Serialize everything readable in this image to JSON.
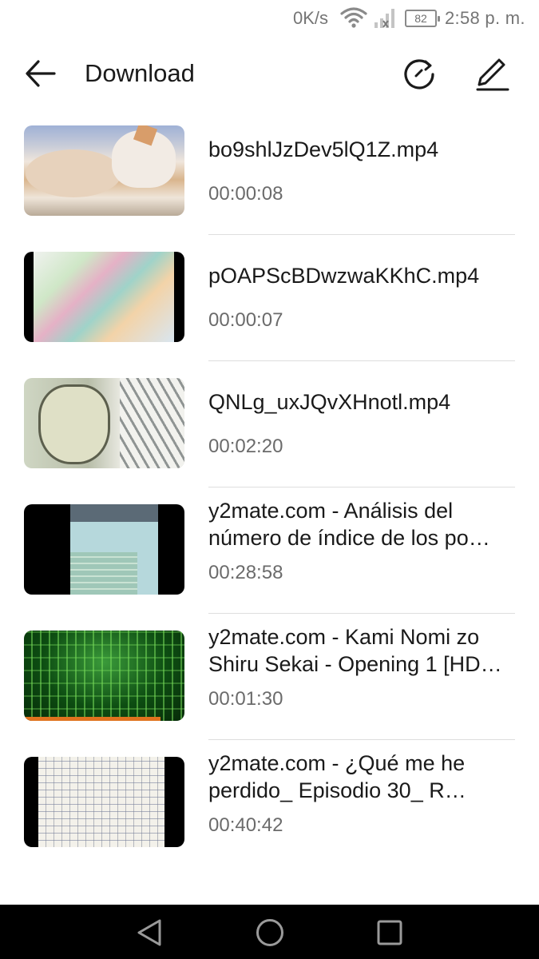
{
  "status_bar": {
    "speed": "0K/s",
    "battery": "82",
    "time": "2:58 p. m."
  },
  "app_bar": {
    "title": "Download",
    "back_icon": "arrow-left-icon",
    "refresh_icon": "refresh-icon",
    "edit_icon": "pencil-icon"
  },
  "videos": [
    {
      "title": "bo9shlJzDev5lQ1Z.mp4",
      "duration": "00:00:08"
    },
    {
      "title": "pOAPScBDwzwaKKhC.mp4",
      "duration": "00:00:07"
    },
    {
      "title": "QNLg_uxJQvXHnotl.mp4",
      "duration": "00:02:20"
    },
    {
      "title": "y2mate.com - Análisis del número de índice de los po…",
      "duration": "00:28:58"
    },
    {
      "title": "y2mate.com - Kami Nomi zo Shiru Sekai - Opening 1 [HD…",
      "duration": "00:01:30"
    },
    {
      "title": "y2mate.com - ¿Qué me he perdido_ Episodio 30_ R…",
      "duration": "00:40:42"
    }
  ],
  "nav_bar": {
    "back_icon": "triangle-back-icon",
    "home_icon": "circle-home-icon",
    "recent_icon": "square-recents-icon"
  }
}
